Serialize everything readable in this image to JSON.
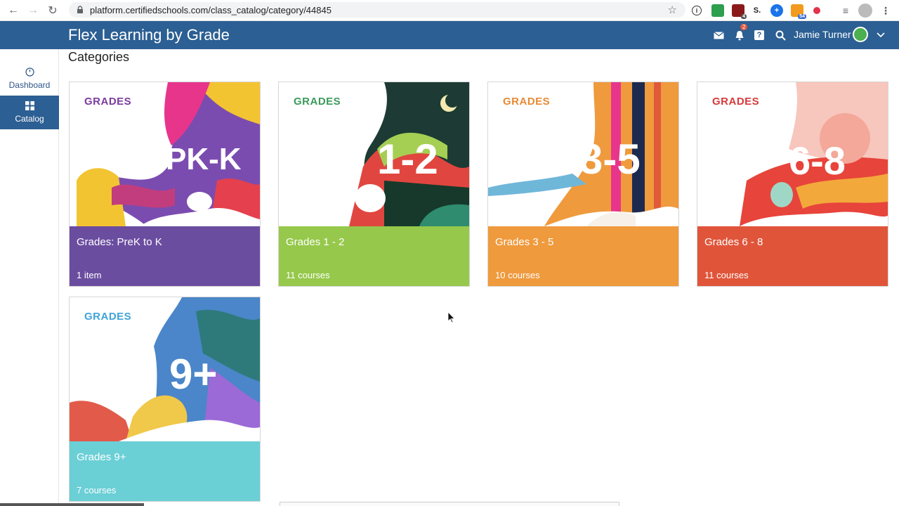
{
  "browser": {
    "url": "platform.certifiedschools.com/class_catalog/category/44845",
    "ext_badge_1": "4",
    "ext_badge_2": "54",
    "ext_s": "S."
  },
  "header": {
    "title": "Flex Learning by Grade",
    "notif_count": "2",
    "user_name": "Jamie Turner"
  },
  "sidebar": {
    "items": [
      {
        "label": "Dashboard",
        "icon": "dashboard-icon"
      },
      {
        "label": "Catalog",
        "icon": "grid-icon"
      }
    ]
  },
  "main": {
    "title": "Categories",
    "cards": [
      {
        "name": "Grades: PreK to K",
        "count": "1 item",
        "art_label": "GRADES",
        "art_big": "PK-K",
        "color": "#6b4da0",
        "label_color": "#7b3a9f"
      },
      {
        "name": "Grades 1 - 2",
        "count": "11 courses",
        "art_label": "GRADES",
        "art_big": "1-2",
        "color": "#96c84b",
        "label_color": "#3a9a5b"
      },
      {
        "name": "Grades 3 - 5",
        "count": "10 courses",
        "art_label": "GRADES",
        "art_big": "3-5",
        "color": "#ef9a3d",
        "label_color": "#e88a35"
      },
      {
        "name": "Grades 6 - 8",
        "count": "11 courses",
        "art_label": "GRADES",
        "art_big": "6-8",
        "color": "#e0553a",
        "label_color": "#d6393c"
      },
      {
        "name": "Grades 9+",
        "count": "7 courses",
        "art_label": "GRADES",
        "art_big": "9+",
        "color": "#6bcfd6",
        "label_color": "#3fa4d8"
      }
    ]
  }
}
